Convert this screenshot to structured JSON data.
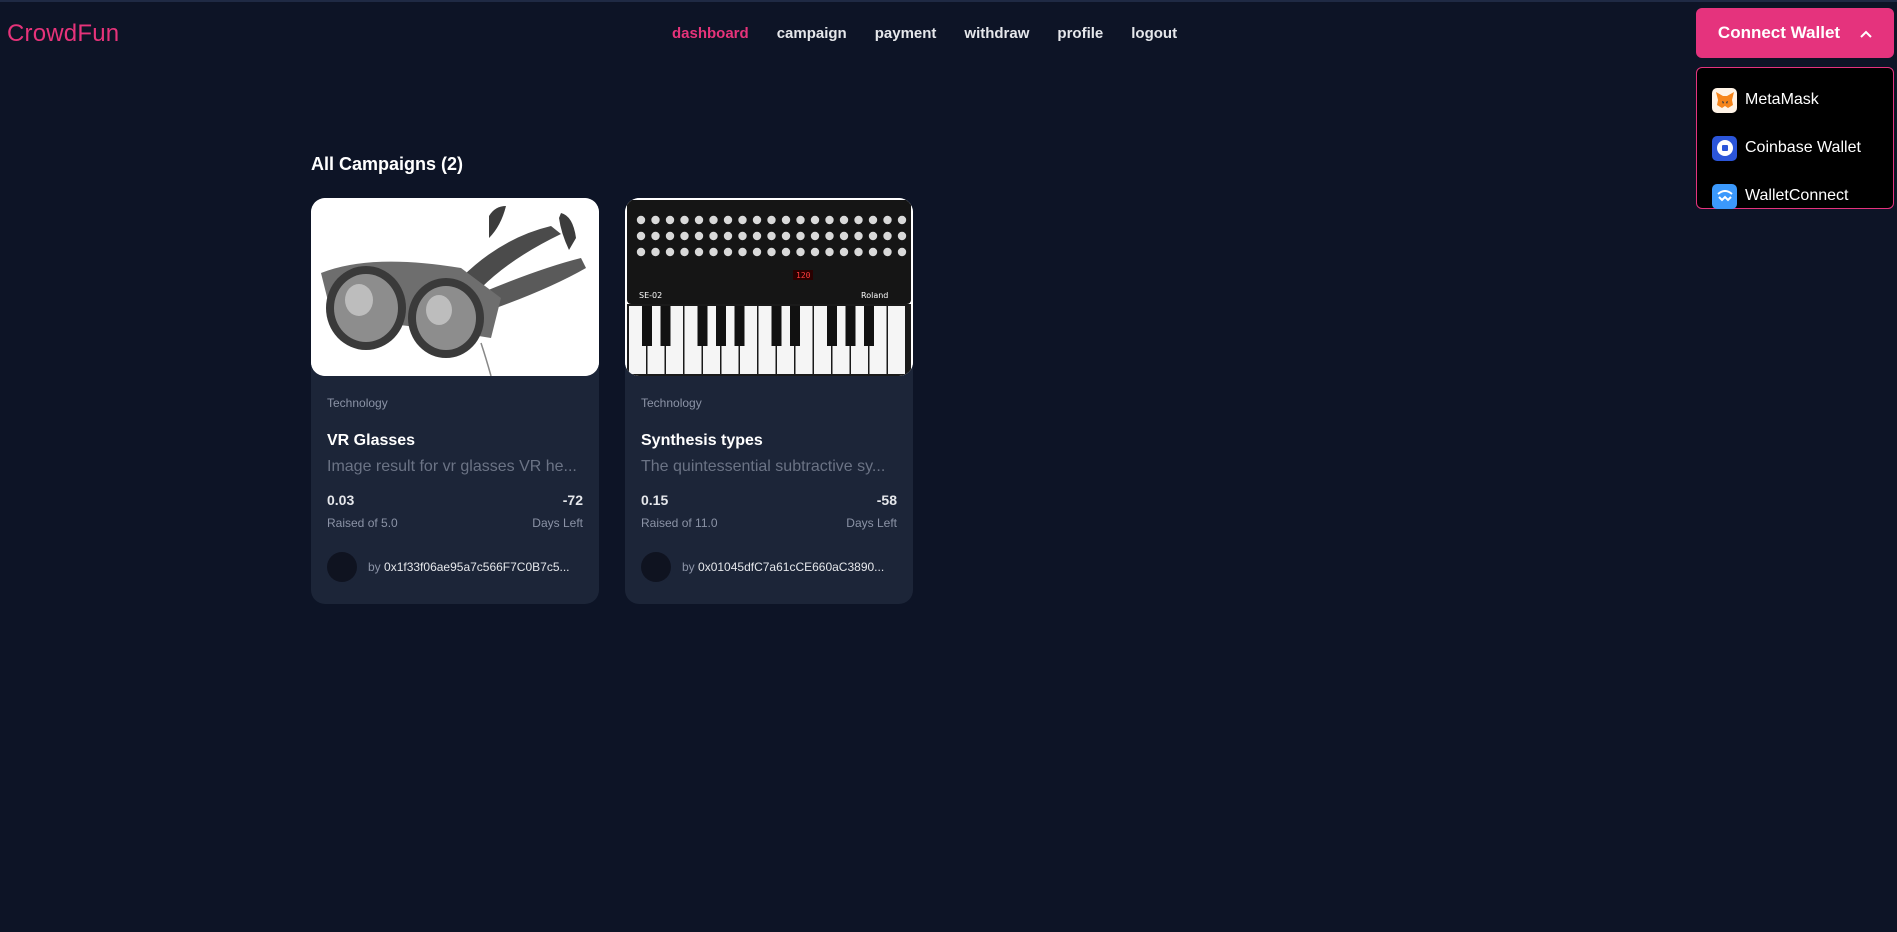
{
  "app": {
    "logo": "CrowdFun"
  },
  "nav": {
    "items": [
      {
        "label": "dashboard",
        "active": true
      },
      {
        "label": "campaign"
      },
      {
        "label": "payment"
      },
      {
        "label": "withdraw"
      },
      {
        "label": "profile"
      },
      {
        "label": "logout"
      }
    ]
  },
  "wallet": {
    "button_label": "Connect Wallet",
    "options": [
      {
        "label": "MetaMask",
        "icon": "metamask-icon"
      },
      {
        "label": "Coinbase Wallet",
        "icon": "coinbase-icon"
      },
      {
        "label": "WalletConnect",
        "icon": "walletconnect-icon"
      }
    ]
  },
  "main": {
    "section_title": "All Campaigns (2)",
    "campaigns": [
      {
        "category": "Technology",
        "title": "VR Glasses",
        "description": "Image result for vr glasses VR he...",
        "raised": "0.03",
        "raised_label": "Raised of 5.0",
        "days": "-72",
        "days_label": "Days Left",
        "by": "by",
        "owner": "0x1f33f06ae95a7c566F7C0B7c5..."
      },
      {
        "category": "Technology",
        "title": "Synthesis types",
        "description": "The quintessential subtractive sy...",
        "raised": "0.15",
        "raised_label": "Raised of 11.0",
        "days": "-58",
        "days_label": "Days Left",
        "by": "by",
        "owner": "0x01045dfC7a61cCE660aC3890..."
      }
    ]
  },
  "colors": {
    "accent": "#e5337d",
    "background": "#0d1426",
    "card": "#1c2538"
  }
}
